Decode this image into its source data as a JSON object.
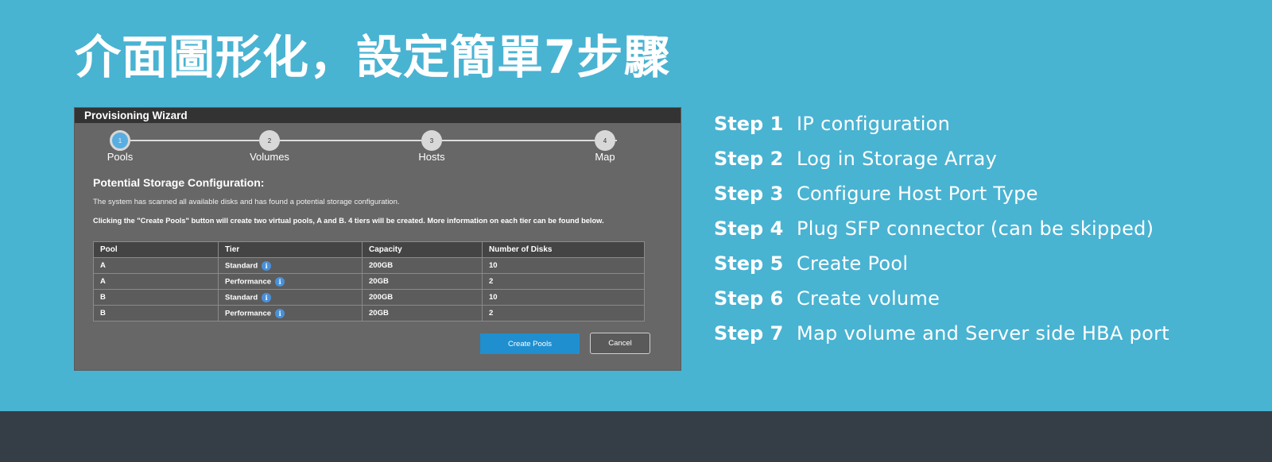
{
  "page": {
    "title": "介面圖形化，設定簡單7步驟"
  },
  "wizard": {
    "window_title": "Provisioning Wizard",
    "steps": [
      {
        "number": "1",
        "label": "Pools",
        "active": true
      },
      {
        "number": "2",
        "label": "Volumes",
        "active": false
      },
      {
        "number": "3",
        "label": "Hosts",
        "active": false
      },
      {
        "number": "4",
        "label": "Map",
        "active": false
      }
    ],
    "heading": "Potential Storage Configuration:",
    "scan_text": "The system has scanned all available disks and has found a potential storage configuration.",
    "info_text": "Clicking the \"Create Pools\" button will create two virtual pools, A and B.  4 tiers will be created. More information on each tier can be found below.",
    "table": {
      "headers": [
        "Pool",
        "Tier",
        "Capacity",
        "Number of Disks"
      ],
      "rows": [
        {
          "pool": "A",
          "tier": "Standard",
          "capacity": "200GB",
          "disks": "10"
        },
        {
          "pool": "A",
          "tier": "Performance",
          "capacity": "20GB",
          "disks": "2"
        },
        {
          "pool": "B",
          "tier": "Standard",
          "capacity": "200GB",
          "disks": "10"
        },
        {
          "pool": "B",
          "tier": "Performance",
          "capacity": "20GB",
          "disks": "2"
        }
      ]
    },
    "create_label": "Create Pools",
    "cancel_label": "Cancel",
    "colors": {
      "titlebar": "#333333",
      "body": "#676767",
      "primary_button": "#1f8fd0",
      "active_step": "#58aee0"
    }
  },
  "steps_list": [
    {
      "name": "Step 1",
      "desc": "IP configuration"
    },
    {
      "name": "Step 2",
      "desc": "Log in Storage Array"
    },
    {
      "name": "Step 3",
      "desc": "Configure Host Port Type"
    },
    {
      "name": "Step 4",
      "desc": "Plug SFP connector (can be skipped)"
    },
    {
      "name": "Step 5",
      "desc": "Create Pool"
    },
    {
      "name": "Step 6",
      "desc": "Create volume"
    },
    {
      "name": "Step 7",
      "desc": "Map volume and Server side HBA port"
    }
  ],
  "theme": {
    "background": "#49b3d2",
    "footer": "#353d46"
  }
}
